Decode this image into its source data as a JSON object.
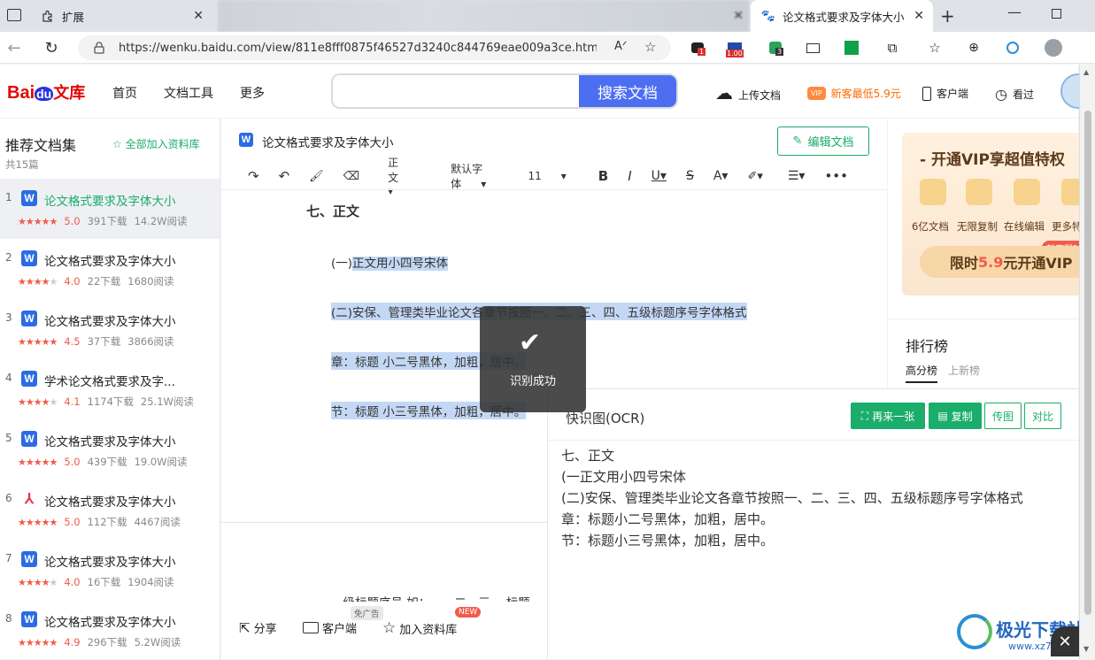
{
  "browser": {
    "tabs": [
      {
        "label": "扩展"
      },
      {
        "label": ""
      },
      {
        "label": "论文格式要求及字体大小"
      }
    ],
    "url": "https://wenku.baidu.com/view/811e8fff0875f46527d3240c844769eae009a3ce.html?fr=...",
    "badges": {
      "ext1": "1",
      "ext2": "1.00",
      "ext3": "3"
    }
  },
  "site": {
    "logo_bai": "Bai",
    "logo_du": "du",
    "logo_wenku": "文库",
    "nav": [
      "首页",
      "文档工具",
      "更多"
    ],
    "search_button": "搜索文档",
    "upload": "上传文档",
    "vip_badge": "VIP",
    "vip_promo": "新客最低5.9元",
    "client": "客户端",
    "viewed": "看过"
  },
  "sidebar": {
    "title": "推荐文档集",
    "add_all": "全部加入资料库",
    "count": "共15篇",
    "docs": [
      {
        "num": "1",
        "title": "论文格式要求及字体大小",
        "score": "5.0",
        "downloads": "391下载",
        "reads": "14.2W阅读",
        "type": "W"
      },
      {
        "num": "2",
        "title": "论文格式要求及字体大小",
        "score": "4.0",
        "downloads": "22下载",
        "reads": "1680阅读",
        "type": "W"
      },
      {
        "num": "3",
        "title": "论文格式要求及字体大小",
        "score": "4.5",
        "downloads": "37下载",
        "reads": "3866阅读",
        "type": "W"
      },
      {
        "num": "4",
        "title": "学术论文格式要求及字...",
        "score": "4.1",
        "downloads": "1174下载",
        "reads": "25.1W阅读",
        "type": "W"
      },
      {
        "num": "5",
        "title": "论文格式要求及字体大小",
        "score": "5.0",
        "downloads": "439下载",
        "reads": "19.0W阅读",
        "type": "W"
      },
      {
        "num": "6",
        "title": "论文格式要求及字体大小",
        "score": "5.0",
        "downloads": "112下载",
        "reads": "4467阅读",
        "type": "PDF"
      },
      {
        "num": "7",
        "title": "论文格式要求及字体大小",
        "score": "4.0",
        "downloads": "16下载",
        "reads": "1904阅读",
        "type": "W"
      },
      {
        "num": "8",
        "title": "论文格式要求及字体大小",
        "score": "4.9",
        "downloads": "296下载",
        "reads": "5.2W阅读",
        "type": "W"
      }
    ]
  },
  "document": {
    "title": "论文格式要求及字体大小",
    "edit_button": "编辑文档",
    "toolbar": {
      "style": "正文",
      "font": "默认字体",
      "size": "11"
    },
    "heading": "七、正文",
    "lines": [
      {
        "prefix": "(一)",
        "text": "正文用小四号宋体"
      },
      {
        "text": "(二)安保、管理类毕业论文各章节按照一、二、三、四、五级标题序号字体格式"
      },
      {
        "text": "章：标题 小二号黑体，加粗，居中。"
      },
      {
        "text": "节：标题 小三号黑体，加粗，居中。"
      }
    ],
    "partial_line": "一级标题序号 如：一、二、三、 标题"
  },
  "footer": {
    "share": "分享",
    "client": "客户端",
    "client_tag": "免广告",
    "add_lib": "加入资料库",
    "new_tag": "NEW"
  },
  "vip": {
    "title": "开通VIP享超值特权",
    "features": [
      "6亿文档",
      "无限复制",
      "在线编辑",
      "更多特"
    ],
    "tag": "新客限时",
    "cta_pre": "限时",
    "cta_price": "5.9",
    "cta_post": "元开通VIP"
  },
  "ranking": {
    "title": "排行榜",
    "tabs": [
      "高分榜",
      "上新榜"
    ]
  },
  "toast": {
    "text": "识别成功"
  },
  "ocr": {
    "title": "快识图(OCR)",
    "buttons": {
      "again": "再来一张",
      "copy": "复制",
      "send": "传图",
      "compare": "对比"
    },
    "lines": [
      "七、正文",
      "(一正文用小四号宋体",
      "(二)安保、管理类毕业论文各章节按照一、二、三、四、五级标题序号字体格式",
      "章：标题小二号黑体，加粗，居中。",
      "节：标题小三号黑体，加粗，居中。"
    ]
  },
  "watermark": {
    "name": "极光下载站",
    "url": "www.xz7.com"
  },
  "colors": {
    "accent": "#4e6ef2",
    "green": "#1aad6b",
    "red": "#f35a4a"
  }
}
